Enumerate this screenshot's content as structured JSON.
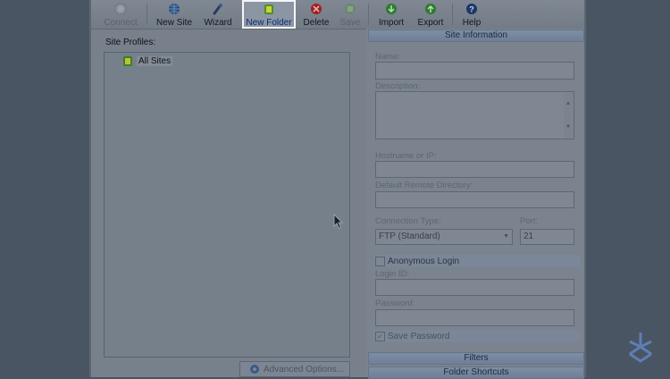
{
  "toolbar": {
    "buttons": [
      {
        "label": "Connect",
        "icon": "connect-icon",
        "enabled": false
      },
      {
        "label": "New Site",
        "icon": "new-site-icon",
        "enabled": true
      },
      {
        "label": "Wizard",
        "icon": "wizard-icon",
        "enabled": true
      },
      {
        "label": "New Folder",
        "icon": "new-folder-icon",
        "enabled": true,
        "active": true
      },
      {
        "label": "Delete",
        "icon": "delete-icon",
        "enabled": true
      },
      {
        "label": "Save",
        "icon": "save-icon",
        "enabled": false
      },
      {
        "label": "Import",
        "icon": "import-icon",
        "enabled": true
      },
      {
        "label": "Export",
        "icon": "export-icon",
        "enabled": true
      },
      {
        "label": "Help",
        "icon": "help-icon",
        "enabled": true
      }
    ]
  },
  "site_profiles": {
    "label": "Site Profiles:",
    "items": [
      {
        "label": "All Sites",
        "icon": "folder-icon"
      }
    ]
  },
  "advanced_button": {
    "label": "Advanced Options...",
    "icon": "gear-icon"
  },
  "site_info": {
    "header": "Site Information",
    "name_label": "Name:",
    "name_value": "",
    "description_label": "Description:",
    "description_value": "",
    "hostname_label": "Hostname or IP:",
    "hostname_value": "",
    "remote_dir_label": "Default Remote Directory:",
    "remote_dir_value": "",
    "connection_type_label": "Connection Type:",
    "connection_type_value": "FTP (Standard)",
    "port_label": "Port:",
    "port_value": "21",
    "anonymous_label": "Anonymous Login",
    "anonymous_checked": false,
    "login_label": "Login ID:",
    "login_value": "",
    "password_label": "Password:",
    "password_value": "",
    "save_password_label": "Save Password",
    "save_password_checked": true
  },
  "sections": {
    "filters": "Filters",
    "folder_shortcuts": "Folder Shortcuts"
  },
  "colors": {
    "accent": "#0a2a78",
    "background": "#4a5564"
  }
}
